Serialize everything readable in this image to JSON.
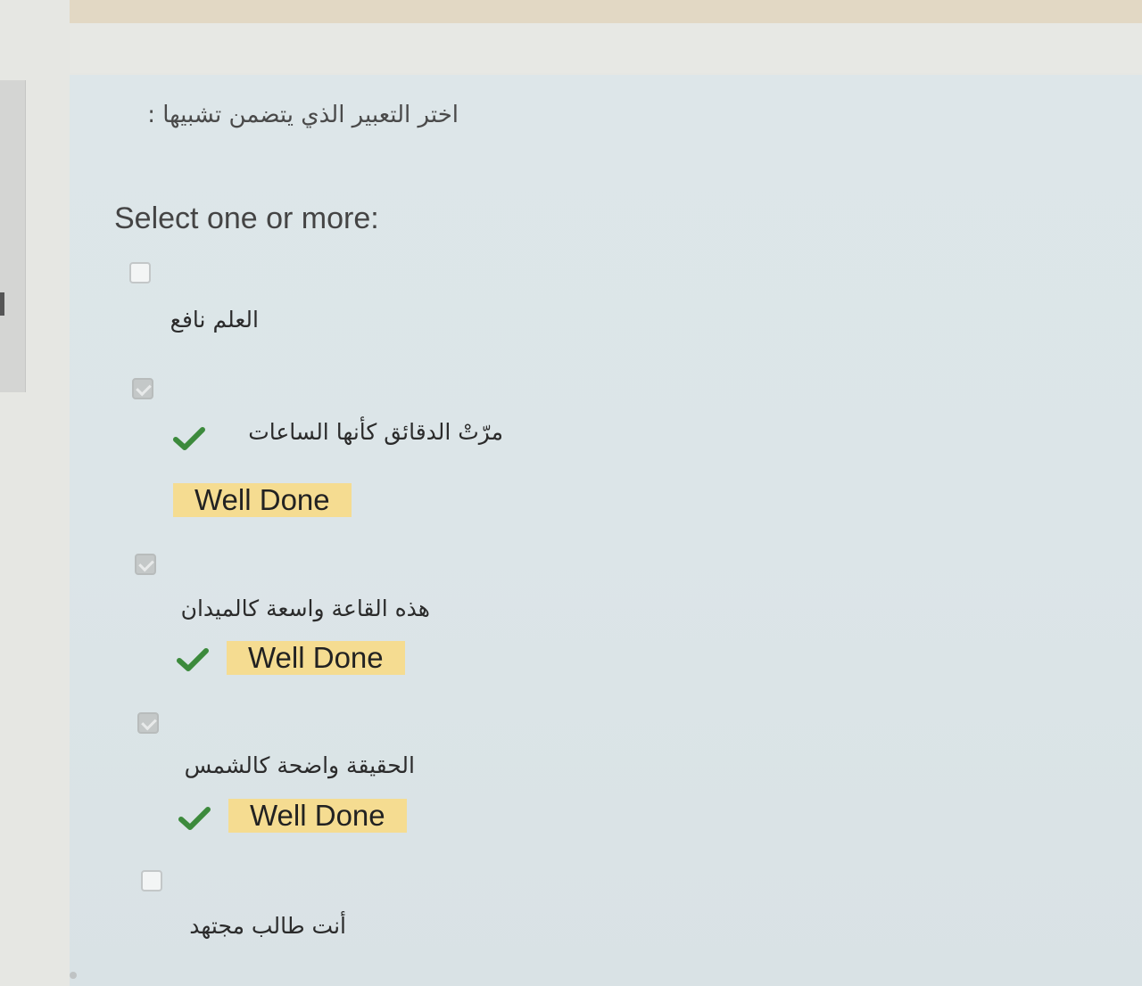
{
  "question": {
    "text": "اختر التعبير الذي يتضمن تشبيها :",
    "prompt": "Select one or more:"
  },
  "options": [
    {
      "label": "العلم نافع",
      "checked": false,
      "correct": false,
      "feedback": ""
    },
    {
      "label": "مرّتْ الدقائق كأنها الساعات",
      "checked": true,
      "correct": true,
      "feedback": "Well Done"
    },
    {
      "label": "هذه القاعة واسعة كالميدان",
      "checked": true,
      "correct": true,
      "feedback": "Well Done"
    },
    {
      "label": "الحقيقة واضحة كالشمس",
      "checked": true,
      "correct": true,
      "feedback": "Well Done"
    },
    {
      "label": "أنت طالب مجتهد",
      "checked": false,
      "correct": false,
      "feedback": ""
    }
  ],
  "colors": {
    "feedback_bg": "#f5dc91",
    "correct_check": "#3c8a3c",
    "panel_bg": "#dce5e8"
  },
  "icons": {
    "correct": "check-icon"
  }
}
